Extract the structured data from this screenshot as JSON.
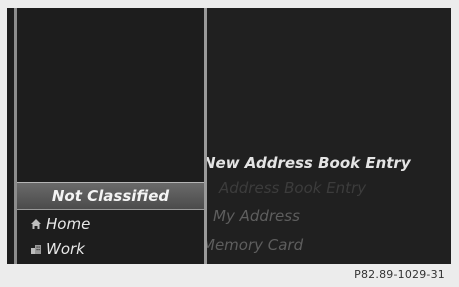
{
  "category_list": {
    "selected_label": "Not Classified",
    "items": [
      {
        "label": "Home",
        "icon": "home-icon"
      },
      {
        "label": "Work",
        "icon": "work-icon"
      }
    ]
  },
  "menu": {
    "items": [
      {
        "label": "New Address Book Entry"
      },
      {
        "label": "Address Book Entry"
      },
      {
        "label": "My Address"
      },
      {
        "label": "Memory Card"
      }
    ]
  },
  "figure_code": "P82.89-1029-31",
  "colors": {
    "screen_bg": "#1d1d1d",
    "highlight": "#5a5a5a",
    "text": "#e8e8e8",
    "page_bg": "#ececec"
  }
}
